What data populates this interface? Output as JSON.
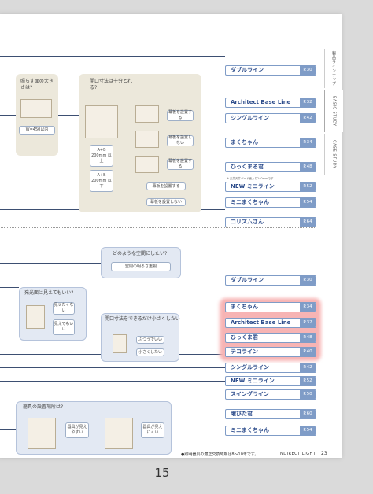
{
  "side_tabs": [
    "製品ラインナップ",
    "BASIC STUDY",
    "CASE STUDY"
  ],
  "top": {
    "q1": "照らす面の大きさは?",
    "q1_size": "W=450以内",
    "q2": "開口寸法は十分とれる?",
    "q2_dim_a": "A+B 200mm 以上",
    "q2_dim_b": "A+B 200mm 以下",
    "opt_install": "幕板を設置する",
    "opt_no_install": "幕板を設置しない",
    "opt_install_2": "幕板を設置する",
    "opt_no_install_2": "幕板を設置しない",
    "note_small": "※ 天井天井ボード面より240mmです"
  },
  "top_products": [
    {
      "name": "ダブルライン",
      "page": "P.30"
    },
    {
      "name": "Architect Base Line",
      "page": "P.32"
    },
    {
      "name": "シングルライン",
      "page": "P.42"
    },
    {
      "name": "まくちゃん",
      "page": "P.34"
    },
    {
      "name": "ひっくまる君",
      "page": "P.48"
    },
    {
      "name": "NEW ミニライン",
      "page": "P.52"
    },
    {
      "name": "ミニまくちゃん",
      "page": "P.54"
    },
    {
      "name": "コリズムさん",
      "page": "P.64"
    }
  ],
  "bottom": {
    "q_space": "どのような空間にしたい?",
    "space_opt": "空間の明るさ重視",
    "q_face": "発光面は見えてもいい?",
    "face_no": "見せたくない",
    "face_yes": "見えてもいい",
    "q_size": "開口寸法をできるだけ小さくしたい",
    "size_normal": "ふつうでいい",
    "size_small": "小さくしたい",
    "q_place": "器具の設置場所は?",
    "place_visible": "器具が見えやすい",
    "place_hidden": "器具が見えにくい"
  },
  "bottom_products": [
    {
      "name": "ダブルライン",
      "page": "P.30"
    },
    {
      "name": "まくちゃん",
      "page": "P.34"
    },
    {
      "name": "Architect Base Line",
      "page": "P.32"
    },
    {
      "name": "ひっくま君",
      "page": "P.48"
    },
    {
      "name": "テコライン",
      "page": "P.40"
    },
    {
      "name": "シングルライン",
      "page": "P.42"
    },
    {
      "name": "NEW ミニライン",
      "page": "P.52"
    },
    {
      "name": "スイングライン",
      "page": "P.50"
    },
    {
      "name": "曜びた君",
      "page": "P.60"
    },
    {
      "name": "ミニまくちゃん",
      "page": "P.54"
    }
  ],
  "footer": {
    "note": "●照明器具の適正交換時期は8～10年です。",
    "section": "INDIRECT LIGHT",
    "page": "23"
  },
  "page_number": "15",
  "colors": {
    "accent": "#7f9cc7",
    "highlight": "#f7b4b4",
    "panel": "#ece8db"
  }
}
